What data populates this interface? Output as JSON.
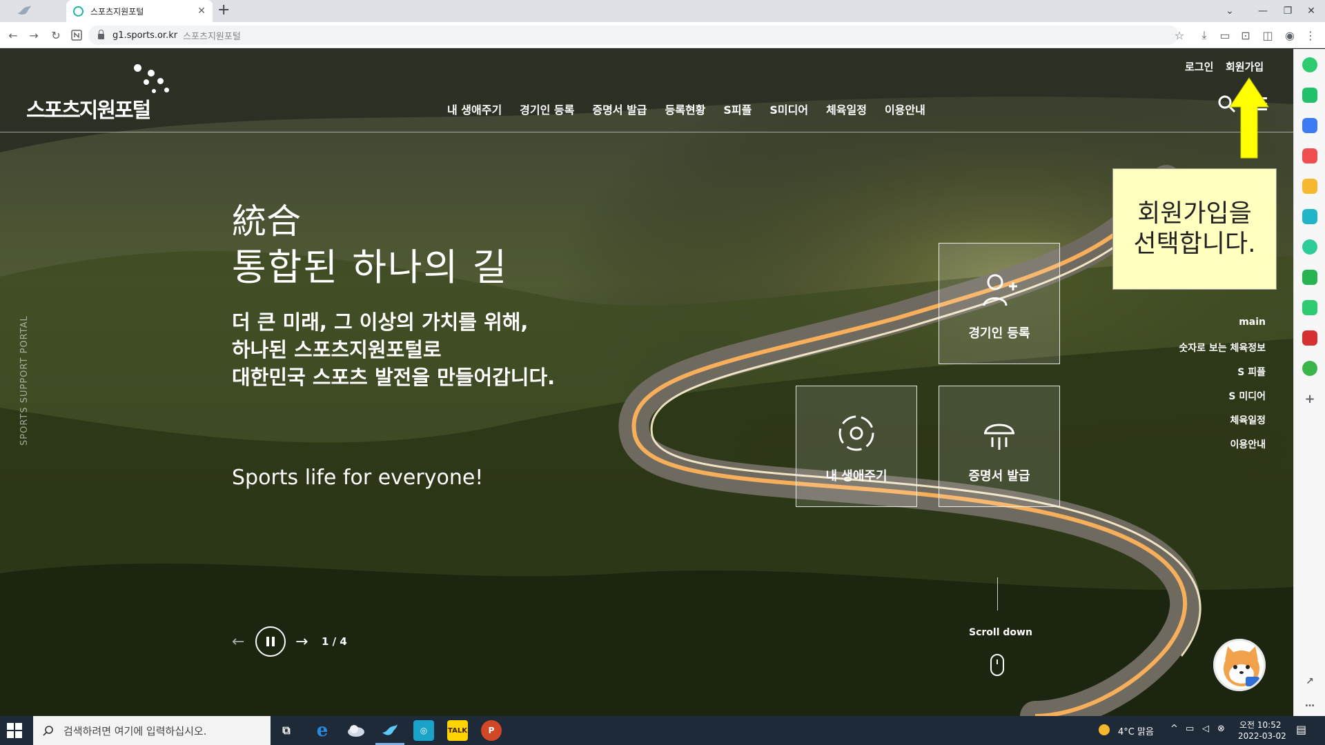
{
  "browser": {
    "tab_title": "스포츠지원포털",
    "tab_close": "✕",
    "new_tab": "+",
    "url_host": "g1.sports.or.kr",
    "url_title": "스포츠지원포털"
  },
  "site": {
    "logo_text": "스포츠지원포털",
    "utility_links": {
      "login": "로그인",
      "signup": "회원가입"
    },
    "gnb": [
      "내 생애주기",
      "경기인 등록",
      "증명서 발급",
      "등록현황",
      "S피플",
      "S미디어",
      "체육일정",
      "이용안내"
    ],
    "vertical_text": "SPORTS SUPPORT PORTAL"
  },
  "hero": {
    "hanja": "統合",
    "title": "통합된 하나의 길",
    "desc_lines": [
      "더 큰 미래, 그 이상의 가치를 위해,",
      "하나된 스포츠지원포털로",
      "대한민국 스포츠 발전을 만들어갑니다."
    ],
    "slogan": "Sports life for everyone!",
    "prev_arrow": "←",
    "next_arrow": "→",
    "pager": "1 / 4"
  },
  "quick_menu": {
    "athlete_register": "경기인 등록",
    "life_cycle": "내 생애주기",
    "certificate": "증명서 발급"
  },
  "side_nav": [
    "main",
    "숫자로 보는 체육정보",
    "S 피플",
    "S 미디어",
    "체육일정",
    "이용안내"
  ],
  "scroll": {
    "label": "Scroll down"
  },
  "annotation": {
    "lines": [
      "회원가입을",
      "선택합니다."
    ]
  },
  "taskbar": {
    "search_placeholder": "검색하려면 여기에 입력하십시오.",
    "weather": "4°C 맑음",
    "time": "오전 10:52",
    "date": "2022-03-02",
    "talk_label": "TALK"
  },
  "colors": {
    "annotation_bg": "#ffffc0",
    "arrow": "#ffff00",
    "taskbar": "#1f2a38",
    "chrome_tab": "#dee1e6"
  }
}
